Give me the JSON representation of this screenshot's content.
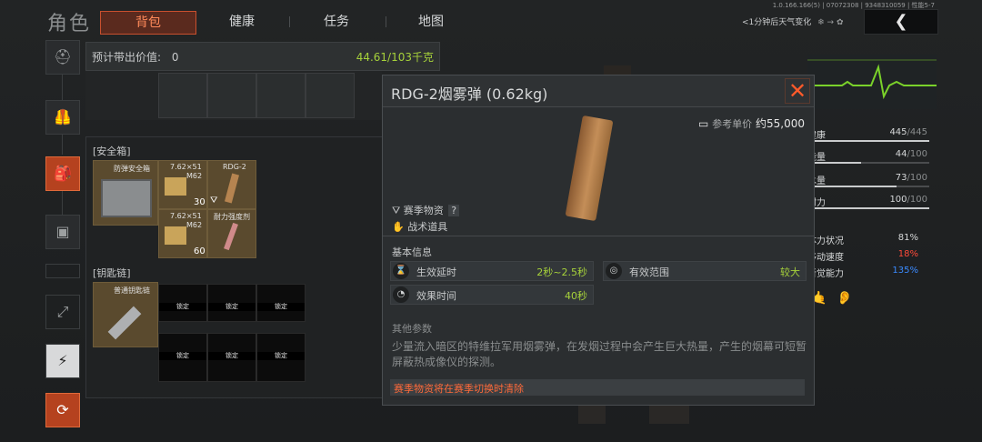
{
  "header": {
    "page_title": "角色",
    "tabs": [
      {
        "label": "背包",
        "active": true
      },
      {
        "label": "健康",
        "active": false
      },
      {
        "label": "任务",
        "active": false
      },
      {
        "label": "地图",
        "active": false
      }
    ],
    "version": "1.0.166.166(5) | 07072308 | 9348310059 | 性能5-7",
    "weather": "<1分钟后天气变化",
    "back_icon": "chevron-left-icon"
  },
  "inventory": {
    "value_label": "预计带出价值:",
    "value": "0",
    "weight": "44.61/103千克",
    "safebox": {
      "label": "[安全箱]",
      "container_name": "防弹安全箱",
      "items": [
        {
          "name": "7.62×51",
          "sub": "M62",
          "qty": "30"
        },
        {
          "name": "RDG-2",
          "sub": "",
          "qty": ""
        },
        {
          "name": "7.62×51",
          "sub": "M62",
          "qty": "60"
        },
        {
          "name": "耐力强度剂",
          "sub": "",
          "qty": ""
        }
      ]
    },
    "keychain": {
      "label": "[钥匙链]",
      "container_name": "普通钥匙链",
      "locked_label": "锁定"
    }
  },
  "popup": {
    "title": "RDG-2烟雾弹 (0.62kg)",
    "price_label": "参考单价",
    "price": "约55,000",
    "tags": [
      "赛季物资",
      "战术道具"
    ],
    "tag_help": "?",
    "basic_info_label": "基本信息",
    "info": [
      {
        "key": "生效延时",
        "value": "2秒~2.5秒",
        "icon": "hourglass-icon"
      },
      {
        "key": "有效范围",
        "value": "较大",
        "icon": "range-icon"
      },
      {
        "key": "效果时间",
        "value": "40秒",
        "icon": "clock-icon"
      }
    ],
    "other_label": "其他参数",
    "description": "少量流入暗区的特维拉军用烟雾弹，在发烟过程中会产生巨大热量，产生的烟幕可短暂屏蔽热成像仪的探测。",
    "warning": "赛季物资将在赛季切换时清除",
    "warning_color": "#ff6a3a"
  },
  "stats": [
    {
      "label": "健康",
      "value": "445",
      "max": "/445",
      "fill": 1.0
    },
    {
      "label": "能量",
      "value": "44",
      "max": "/100",
      "fill": 0.44
    },
    {
      "label": "水量",
      "value": "73",
      "max": "/100",
      "fill": 0.73
    },
    {
      "label": "耐力",
      "value": "100",
      "max": "/100",
      "fill": 1.0
    }
  ],
  "modifiers": [
    {
      "label": "体力状况",
      "value": "81%",
      "color": "#d6d8d9"
    },
    {
      "label": "移动速度",
      "value": "18%",
      "color": "#ff4a3a"
    },
    {
      "label": "听觉能力",
      "value": "135%",
      "color": "#3a8aff"
    }
  ],
  "colors": {
    "accent": "#c8502e",
    "positive": "#a6d13a",
    "ecg": "#7ad12a"
  }
}
